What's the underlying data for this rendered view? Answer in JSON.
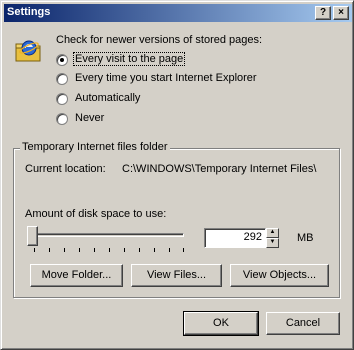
{
  "window": {
    "title": "Settings"
  },
  "titlebar": {
    "help_glyph": "?",
    "close_glyph": "×"
  },
  "check": {
    "prompt": "Check for newer versions of stored pages:",
    "options": [
      {
        "label": "Every visit to the page",
        "selected": true
      },
      {
        "label": "Every time you start Internet Explorer",
        "selected": false
      },
      {
        "label": "Automatically",
        "selected": false
      },
      {
        "label": "Never",
        "selected": false
      }
    ]
  },
  "folder": {
    "group_label": "Temporary Internet files folder",
    "current_location_label": "Current location:",
    "current_location_value": "C:\\WINDOWS\\Temporary Internet Files\\",
    "amount_label": "Amount of disk space to use:",
    "disk_space_value": "292",
    "disk_space_unit": "MB",
    "slider_level": 0.02,
    "buttons": {
      "move": "Move Folder...",
      "view_files": "View Files...",
      "view_objects": "View Objects..."
    }
  },
  "footer": {
    "ok": "OK",
    "cancel": "Cancel"
  },
  "icons": {
    "help": "help-icon",
    "close": "close-icon",
    "ie": "internet-explorer-icon"
  }
}
